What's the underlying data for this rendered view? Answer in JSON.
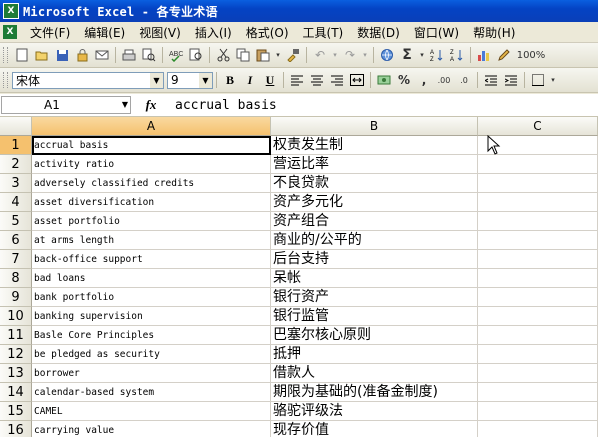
{
  "window": {
    "title": "Microsoft Excel - 各专业术语"
  },
  "menu": [
    "文件(F)",
    "编辑(E)",
    "视图(V)",
    "插入(I)",
    "格式(O)",
    "工具(T)",
    "数据(D)",
    "窗口(W)",
    "帮助(H)"
  ],
  "format_toolbar": {
    "font": "宋体",
    "size": "9"
  },
  "standard_toolbar": {
    "zoom": "100%"
  },
  "formula_bar": {
    "name_box": "A1",
    "fx_label": "fx",
    "value": "accrual basis"
  },
  "columns": [
    "A",
    "B",
    "C"
  ],
  "rows": [
    {
      "num": "1",
      "a": "accrual basis",
      "b": "权责发生制"
    },
    {
      "num": "2",
      "a": "activity ratio",
      "b": "营运比率"
    },
    {
      "num": "3",
      "a": "adversely classified credits",
      "b": "不良贷款"
    },
    {
      "num": "4",
      "a": "asset diversification",
      "b": "资产多元化"
    },
    {
      "num": "5",
      "a": "asset portfolio",
      "b": "资产组合"
    },
    {
      "num": "6",
      "a": "at arms length",
      "b": "商业的/公平的"
    },
    {
      "num": "7",
      "a": "back-office support",
      "b": "后台支持"
    },
    {
      "num": "8",
      "a": "bad loans",
      "b": "呆帐"
    },
    {
      "num": "9",
      "a": "bank portfolio",
      "b": "银行资产"
    },
    {
      "num": "10",
      "a": "banking supervision",
      "b": "银行监管"
    },
    {
      "num": "11",
      "a": "Basle Core Principles",
      "b": "巴塞尔核心原则"
    },
    {
      "num": "12",
      "a": "be pledged as security",
      "b": "抵押"
    },
    {
      "num": "13",
      "a": "borrower",
      "b": "借款人"
    },
    {
      "num": "14",
      "a": "calendar-based system",
      "b": "期限为基础的(准备金制度)"
    },
    {
      "num": "15",
      "a": "CAMEL",
      "b": "骆驼评级法"
    },
    {
      "num": "16",
      "a": "carrying value",
      "b": "现存价值"
    }
  ]
}
